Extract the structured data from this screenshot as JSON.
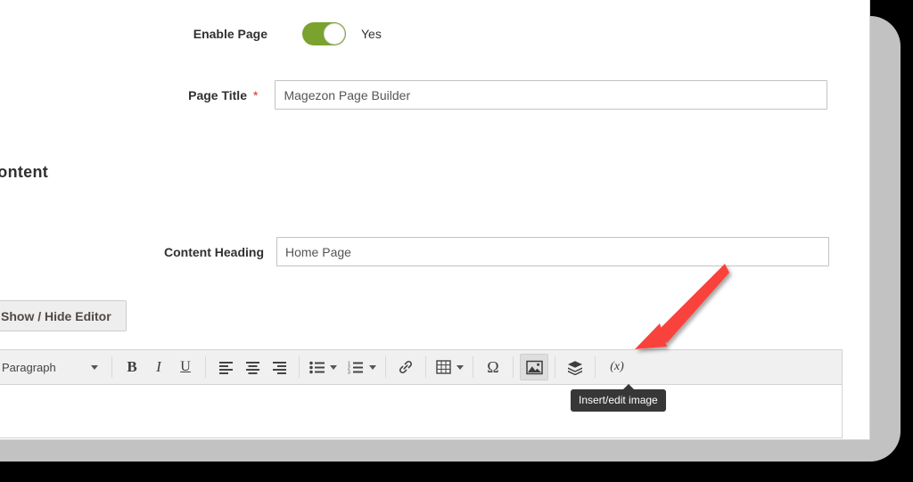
{
  "form": {
    "enable_page": {
      "label": "Enable Page",
      "toggle_state": "on",
      "toggle_value_text": "Yes",
      "toggle_on_color": "#79a22e"
    },
    "page_title": {
      "label": "Page Title",
      "required_marker": "*",
      "required_marker_color": "#e02b27",
      "value": "Magezon Page Builder",
      "placeholder": ""
    }
  },
  "content_section": {
    "heading": "Content",
    "content_heading_field": {
      "label": "Content Heading",
      "value": "Home Page",
      "placeholder": ""
    },
    "show_hide_editor_button": "Show / Hide Editor"
  },
  "editor": {
    "format_select": {
      "value": "Paragraph",
      "icon": "chevron-down-icon"
    },
    "buttons": [
      {
        "name": "bold",
        "glyph": "B",
        "title": "Bold",
        "active": false
      },
      {
        "name": "italic",
        "glyph": "I",
        "title": "Italic",
        "active": false
      },
      {
        "name": "underline",
        "glyph": "U",
        "title": "Underline",
        "active": false
      },
      {
        "name": "align-left",
        "glyph": "align-left-icon",
        "title": "Align left",
        "active": false
      },
      {
        "name": "align-center",
        "glyph": "align-center-icon",
        "title": "Align center",
        "active": false
      },
      {
        "name": "align-right",
        "glyph": "align-right-icon",
        "title": "Align right",
        "active": false
      },
      {
        "name": "bullet-list",
        "glyph": "bullet-list-icon",
        "title": "Bullet list",
        "active": false
      },
      {
        "name": "numbered-list",
        "glyph": "numbered-list-icon",
        "title": "Numbered list",
        "active": false
      },
      {
        "name": "insert-link",
        "glyph": "link-icon",
        "title": "Insert/edit link",
        "active": false
      },
      {
        "name": "table",
        "glyph": "table-icon",
        "title": "Table",
        "active": false
      },
      {
        "name": "special-character",
        "glyph": "Ω",
        "title": "Special character",
        "active": false
      },
      {
        "name": "insert-image",
        "glyph": "image-icon",
        "title": "Insert/edit image",
        "active": true
      },
      {
        "name": "insert-widget",
        "glyph": "widget-icon",
        "title": "Insert Widget",
        "active": false
      },
      {
        "name": "insert-variable",
        "glyph": "(x)",
        "title": "Insert Variable",
        "active": false
      }
    ],
    "tooltip": {
      "text": "Insert/edit image",
      "background": "#373737"
    },
    "body_text": ""
  },
  "annotation": {
    "arrow_color": "#f9423a",
    "points_to": "insert-image"
  }
}
